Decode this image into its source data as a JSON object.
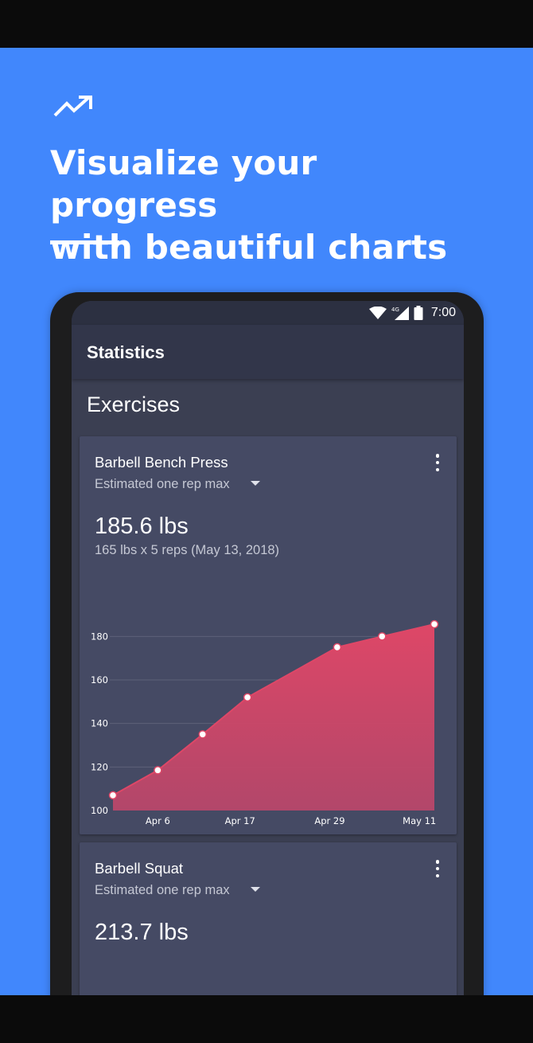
{
  "promo": {
    "headline_line1": "Visualize your progress",
    "headline_line2": "with beautiful charts",
    "icon": "trending-up-icon",
    "background_color": "#4187fc"
  },
  "status_bar": {
    "network": "4G",
    "time": "7:00"
  },
  "app_bar": {
    "title": "Statistics"
  },
  "section": {
    "title": "Exercises"
  },
  "cards": [
    {
      "exercise": "Barbell Bench Press",
      "metric": "Estimated one rep max",
      "value": "185.6 lbs",
      "detail": "165 lbs x 5 reps (May 13, 2018)"
    },
    {
      "exercise": "Barbell Squat",
      "metric": "Estimated one rep max",
      "value": "213.7 lbs"
    }
  ],
  "chart_data": {
    "type": "area",
    "x": [
      "Mar 31",
      "Apr 6",
      "Apr 12",
      "Apr 18",
      "Apr 24",
      "Apr 30",
      "May 6",
      "May 13"
    ],
    "values": [
      107,
      118.5,
      135,
      152,
      175,
      180,
      185.6
    ],
    "point_dates": [
      "Mar 31",
      "Apr 6",
      "Apr 12",
      "Apr 18",
      "Apr 30",
      "May 6",
      "May 13"
    ],
    "x_tick_labels": [
      "Apr 6",
      "Apr 17",
      "Apr 29",
      "May 11"
    ],
    "y_ticks": [
      100,
      120,
      140,
      160,
      180
    ],
    "ylim": [
      100,
      190
    ],
    "grid": true,
    "fill_color": "#de4767",
    "point_color": "#ffffff"
  }
}
